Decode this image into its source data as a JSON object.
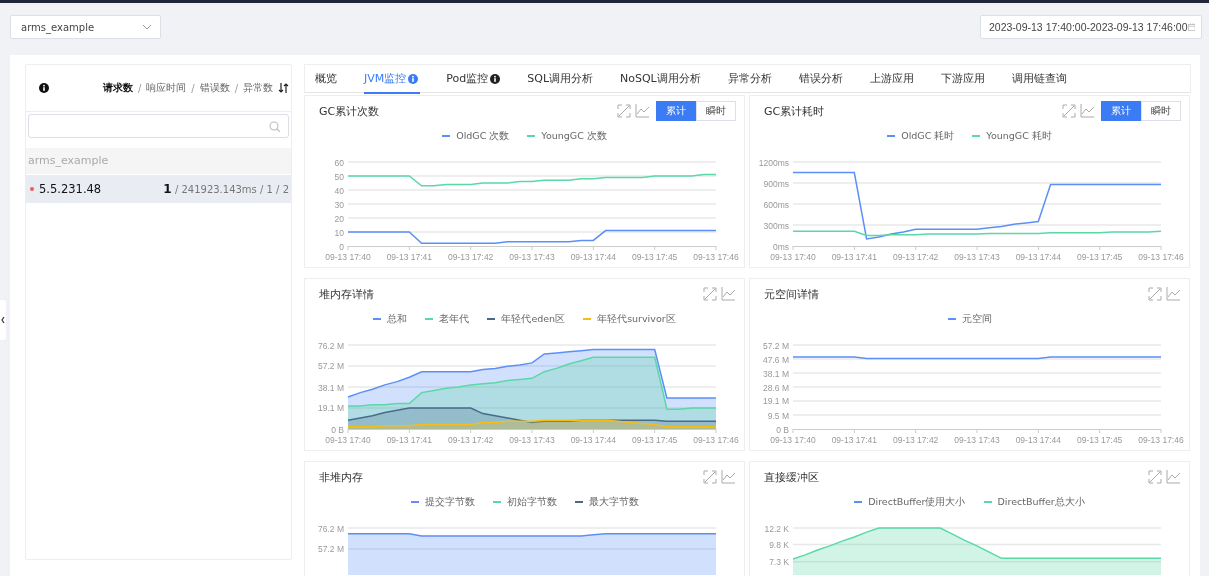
{
  "app_select": {
    "value": "arms_example"
  },
  "time_range": {
    "value": "2023-09-13 17:40:00-2023-09-13 17:46:00"
  },
  "instance_panel": {
    "sort_options": [
      {
        "label": "请求数",
        "selected": true
      },
      {
        "label": "响应时间",
        "selected": false
      },
      {
        "label": "错误数",
        "selected": false
      },
      {
        "label": "异常数",
        "selected": false
      }
    ],
    "separators": [
      "/",
      "/",
      "/"
    ],
    "groups": [
      {
        "name": "arms_example",
        "instances": [
          {
            "name": "5.5.231.48",
            "color": "#f05a5a",
            "selected": true,
            "stats": "**1** / 241923.143ms / 1 / 2"
          }
        ]
      }
    ]
  },
  "tabs": [
    {
      "label": "概览",
      "selected": false,
      "info": false
    },
    {
      "label": "JVM监控",
      "selected": true,
      "info": true
    },
    {
      "label": "Pod监控",
      "selected": false,
      "info": true
    },
    {
      "label": "SQL调用分析",
      "selected": false,
      "info": false
    },
    {
      "label": "NoSQL调用分析",
      "selected": false,
      "info": false
    },
    {
      "label": "异常分析",
      "selected": false,
      "info": false
    },
    {
      "label": "错误分析",
      "selected": false,
      "info": false
    },
    {
      "label": "上游应用",
      "selected": false,
      "info": false
    },
    {
      "label": "下游应用",
      "selected": false,
      "info": false
    },
    {
      "label": "调用链查询",
      "selected": false,
      "info": false
    }
  ],
  "charts": [
    {
      "title": "GC累计次数",
      "mode_toggle": [
        {
          "label": "累计",
          "selected": true
        },
        {
          "label": "瞬时",
          "selected": false
        }
      ],
      "chart_data": {
        "type": "line",
        "grid": true,
        "ylim": [
          0,
          60
        ],
        "categories": [
          "09-13 17:40",
          null,
          null,
          null,
          null,
          "09-13 17:41",
          null,
          null,
          null,
          null,
          "09-13 17:42",
          null,
          null,
          null,
          null,
          "09-13 17:43",
          null,
          null,
          null,
          null,
          "09-13 17:44",
          null,
          null,
          null,
          null,
          "09-13 17:45",
          null,
          null,
          null,
          null,
          "09-13 17:46"
        ],
        "yticks": [
          0,
          10,
          20,
          30,
          40,
          50,
          60
        ],
        "series": [
          {
            "name": "OldGC 次数",
            "color": "#5b8ff9",
            "values": [
              10,
              10,
              10,
              10,
              10,
              10,
              2,
              2,
              2,
              2,
              2,
              2,
              2,
              3,
              3,
              3,
              3,
              3,
              3,
              4,
              4,
              11,
              11,
              11,
              11,
              11,
              11,
              11,
              11,
              11,
              11
            ]
          },
          {
            "name": "YoungGC 次数",
            "color": "#5ad8a6",
            "values": [
              50,
              50,
              50,
              50,
              50,
              50,
              43,
              43,
              44,
              44,
              44,
              45,
              45,
              45,
              46,
              46,
              47,
              47,
              47,
              48,
              48,
              49,
              49,
              49,
              49,
              50,
              50,
              50,
              50,
              51,
              51
            ]
          }
        ]
      }
    },
    {
      "title": "GC累计耗时",
      "mode_toggle": [
        {
          "label": "累计",
          "selected": true
        },
        {
          "label": "瞬时",
          "selected": false
        }
      ],
      "chart_data": {
        "type": "line",
        "grid": true,
        "ylim": [
          0,
          1200
        ],
        "categories": [
          "09-13 17:40",
          null,
          null,
          null,
          null,
          "09-13 17:41",
          null,
          null,
          null,
          null,
          "09-13 17:42",
          null,
          null,
          null,
          null,
          "09-13 17:43",
          null,
          null,
          null,
          null,
          "09-13 17:44",
          null,
          null,
          null,
          null,
          "09-13 17:45",
          null,
          null,
          null,
          null,
          "09-13 17:46"
        ],
        "yticks": [
          {
            "value": 0,
            "label": "0ms"
          },
          {
            "value": 300,
            "label": "300ms"
          },
          {
            "value": 600,
            "label": "600ms"
          },
          {
            "value": 900,
            "label": "900ms"
          },
          {
            "value": 1200,
            "label": "1200ms"
          }
        ],
        "series": [
          {
            "name": "OldGC 耗时",
            "color": "#5b8ff9",
            "values": [
              1050,
              1050,
              1050,
              1050,
              1050,
              1050,
              100,
              130,
              170,
              200,
              240,
              240,
              240,
              240,
              240,
              240,
              260,
              280,
              310,
              330,
              350,
              880,
              880,
              880,
              880,
              880,
              880,
              880,
              880,
              880,
              880
            ]
          },
          {
            "name": "YoungGC 耗时",
            "color": "#5ad8a6",
            "values": [
              210,
              210,
              210,
              210,
              210,
              210,
              150,
              150,
              160,
              160,
              160,
              170,
              170,
              170,
              170,
              170,
              180,
              180,
              180,
              180,
              180,
              190,
              190,
              190,
              190,
              190,
              200,
              200,
              200,
              200,
              210
            ]
          }
        ]
      }
    },
    {
      "title": "堆内存详情",
      "chart_data": {
        "type": "area",
        "stacked": false,
        "grid": true,
        "ylim": [
          0,
          76.2
        ],
        "categories": [
          "09-13 17:40",
          null,
          null,
          null,
          null,
          "09-13 17:41",
          null,
          null,
          null,
          null,
          "09-13 17:42",
          null,
          null,
          null,
          null,
          "09-13 17:43",
          null,
          null,
          null,
          null,
          "09-13 17:44",
          null,
          null,
          null,
          null,
          "09-13 17:45",
          null,
          null,
          null,
          null,
          "09-13 17:46"
        ],
        "yticks": [
          {
            "value": 0,
            "label": "0 B"
          },
          {
            "value": 19.1,
            "label": "19.1 M"
          },
          {
            "value": 38.1,
            "label": "38.1 M"
          },
          {
            "value": 57.2,
            "label": "57.2 M"
          },
          {
            "value": 76.2,
            "label": "76.2 M"
          }
        ],
        "series": [
          {
            "name": "总和",
            "color": "#5b8ff9",
            "values": [
              29,
              33,
              36,
              40,
              43,
              47,
              52,
              52,
              52,
              52,
              52,
              54,
              55,
              57,
              58,
              60,
              68,
              69,
              70,
              71,
              72,
              72,
              72,
              72,
              72,
              72,
              28,
              28,
              28,
              28,
              28
            ]
          },
          {
            "name": "老年代",
            "color": "#5ad8a6",
            "values": [
              21,
              21,
              22,
              22,
              23,
              23,
              33,
              35,
              37,
              38,
              40,
              41,
              42,
              44,
              45,
              46,
              52,
              55,
              59,
              62,
              65,
              65,
              65,
              65,
              65,
              65,
              18,
              18,
              19,
              19,
              19
            ]
          },
          {
            "name": "年轻代eden区",
            "color": "#4a6a8c",
            "values": [
              8,
              10,
              12,
              15,
              17,
              19,
              19,
              19,
              19,
              19,
              19,
              14,
              12,
              10,
              8,
              6,
              7,
              7,
              7,
              8,
              8,
              8,
              8,
              8,
              8,
              8,
              7,
              7,
              7,
              7,
              7
            ]
          },
          {
            "name": "年轻代survivor区",
            "color": "#f6bd16",
            "values": [
              2,
              2,
              2,
              3,
              3,
              3,
              4,
              4,
              4,
              4,
              4,
              6,
              6,
              7,
              7,
              7,
              8,
              8,
              8,
              8,
              8,
              8,
              7,
              6,
              5,
              4,
              2,
              2,
              2,
              2,
              2
            ]
          }
        ]
      }
    },
    {
      "title": "元空间详情",
      "chart_data": {
        "type": "line",
        "grid": true,
        "ylim": [
          0,
          57.2
        ],
        "categories": [
          "09-13 17:40",
          null,
          null,
          null,
          null,
          "09-13 17:41",
          null,
          null,
          null,
          null,
          "09-13 17:42",
          null,
          null,
          null,
          null,
          "09-13 17:43",
          null,
          null,
          null,
          null,
          "09-13 17:44",
          null,
          null,
          null,
          null,
          "09-13 17:45",
          null,
          null,
          null,
          null,
          "09-13 17:46"
        ],
        "yticks": [
          {
            "value": 0,
            "label": "0 B"
          },
          {
            "value": 9.5,
            "label": "9.5 M"
          },
          {
            "value": 19.1,
            "label": "19.1 M"
          },
          {
            "value": 28.6,
            "label": "28.6 M"
          },
          {
            "value": 38.1,
            "label": "38.1 M"
          },
          {
            "value": 47.6,
            "label": "47.6 M"
          },
          {
            "value": 57.2,
            "label": "57.2 M"
          }
        ],
        "series": [
          {
            "name": "元空间",
            "color": "#5b8ff9",
            "values": [
              49,
              49,
              49,
              49,
              49,
              49,
              48,
              48,
              48,
              48,
              48,
              48,
              48,
              48,
              48,
              48,
              48,
              48,
              48,
              48,
              48,
              49,
              49,
              49,
              49,
              49,
              49,
              49,
              49,
              49,
              49
            ]
          }
        ]
      }
    },
    {
      "title": "非堆内存",
      "chart_data": {
        "type": "area",
        "grid": true,
        "ylim": [
          0,
          76.2
        ],
        "categories": [
          null,
          null,
          null,
          null,
          null,
          null,
          null,
          null,
          null,
          null,
          null,
          null,
          null,
          null,
          null,
          null,
          null,
          null,
          null,
          null,
          null,
          null,
          null,
          null,
          null,
          null,
          null,
          null,
          null,
          null,
          null
        ],
        "yticks": [
          {
            "value": 57.2,
            "label": "57.2 M"
          },
          {
            "value": 76.2,
            "label": "76.2 M"
          }
        ],
        "series": [
          {
            "name": "提交字节数",
            "color": "#5b8ff9",
            "values": [
              71,
              71,
              71,
              71,
              71,
              71,
              69,
              69,
              69,
              69,
              69,
              69,
              69,
              69,
              69,
              69,
              69,
              69,
              69,
              69,
              70,
              71,
              71,
              71,
              71,
              71,
              71,
              71,
              71,
              71,
              71
            ]
          },
          {
            "name": "初始字节数",
            "color": "#5ad8a6",
            "values": [
              null,
              null,
              null,
              null,
              null,
              null,
              null,
              null,
              null,
              null,
              null,
              null,
              null,
              null,
              null,
              null,
              null,
              null,
              null,
              null,
              null,
              null,
              null,
              null,
              null,
              null,
              null,
              null,
              null,
              null,
              null
            ]
          },
          {
            "name": "最大字节数",
            "color": "#4a6a8c",
            "values": [
              null,
              null,
              null,
              null,
              null,
              null,
              null,
              null,
              null,
              null,
              null,
              null,
              null,
              null,
              null,
              null,
              null,
              null,
              null,
              null,
              null,
              null,
              null,
              null,
              null,
              null,
              null,
              null,
              null,
              null,
              null
            ]
          }
        ]
      }
    },
    {
      "title": "直接缓冲区",
      "chart_data": {
        "type": "area",
        "grid": true,
        "ylim": [
          0,
          12.2
        ],
        "categories": [
          null,
          null,
          null,
          null,
          null,
          null,
          null,
          null,
          null,
          null,
          null,
          null,
          null,
          null,
          null,
          null,
          null,
          null,
          null,
          null,
          null,
          null,
          null,
          null,
          null,
          null,
          null,
          null,
          null,
          null,
          null
        ],
        "yticks": [
          {
            "value": 7.3,
            "label": "7.3 K"
          },
          {
            "value": 9.8,
            "label": "9.8 K"
          },
          {
            "value": 12.2,
            "label": "12.2 K"
          }
        ],
        "series": [
          {
            "name": "DirectBuffer使用大小",
            "color": "#5b8ff9",
            "values": [
              null,
              null,
              null,
              null,
              null,
              null,
              null,
              null,
              null,
              null,
              null,
              null,
              null,
              null,
              null,
              null,
              null,
              null,
              null,
              null,
              null,
              null,
              null,
              null,
              null,
              null,
              null,
              null,
              null,
              null,
              null
            ]
          },
          {
            "name": "DirectBuffer总大小",
            "color": "#5ad8a6",
            "values": [
              7.7,
              8.3,
              9,
              9.6,
              10.3,
              10.9,
              11.6,
              12.2,
              12.2,
              12.2,
              12.2,
              12.2,
              12.2,
              11.3,
              10.4,
              9.6,
              8.7,
              7.8,
              7.8,
              7.8,
              7.8,
              7.8,
              7.8,
              7.8,
              7.8,
              7.8,
              7.8,
              7.8,
              7.8,
              7.8,
              7.8
            ]
          }
        ]
      }
    }
  ]
}
